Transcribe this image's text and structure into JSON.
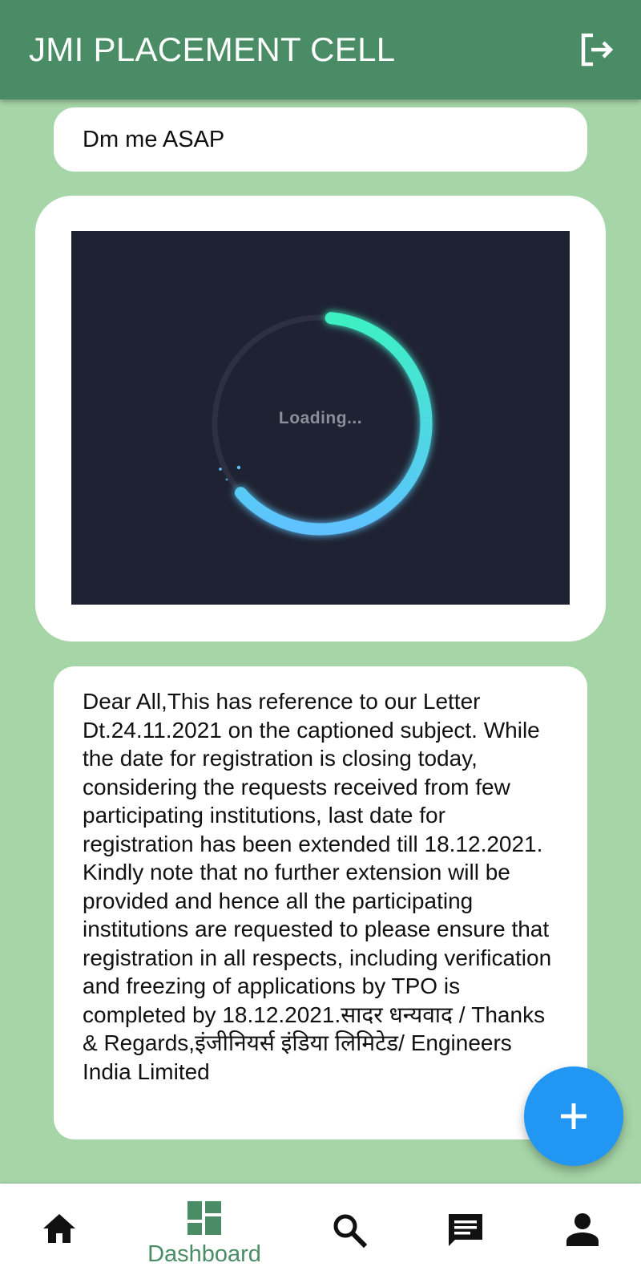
{
  "app_bar": {
    "title": "JMI PLACEMENT CELL",
    "logout_icon": "logout-icon"
  },
  "feed": {
    "posts": [
      {
        "text": "Dm me ASAP"
      },
      {
        "media_label": "Loading...",
        "progress": 0.62
      },
      {
        "text": "Dear All,This has reference to our Letter Dt.24.11.2021 on the captioned subject. While the date for registration is closing today, considering the requests received from few participating institutions, last date for registration has been extended till 18.12.2021.  Kindly note that no further extension will be provided and hence all the participating institutions are requested to please ensure that registration in all respects, including verification and freezing of applications by TPO is completed by 18.12.2021.सादर धन्यवाद / Thanks & Regards,इंजीनियर्स इंडिया लिमिटेड/ Engineers India Limited"
      }
    ]
  },
  "fab": {
    "icon": "plus-icon"
  },
  "bottom_nav": {
    "items": [
      {
        "icon": "home-icon",
        "label": ""
      },
      {
        "icon": "dashboard-icon",
        "label": "Dashboard"
      },
      {
        "icon": "search-icon",
        "label": ""
      },
      {
        "icon": "chat-icon",
        "label": ""
      },
      {
        "icon": "person-icon",
        "label": ""
      }
    ],
    "active_index": 1
  },
  "colors": {
    "app_bar": "#4a8c66",
    "background": "#a6d5a7",
    "fab": "#2196f3",
    "active_nav": "#4a8c66",
    "media_bg": "#1f2232",
    "spinner_start": "#3df0c2",
    "spinner_end": "#5ec2ff"
  }
}
